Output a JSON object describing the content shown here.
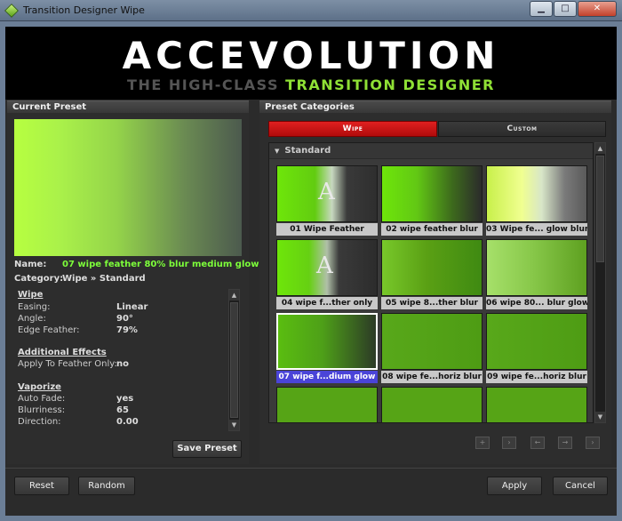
{
  "window": {
    "title": "Transition Designer Wipe",
    "minimize": "▁",
    "maximize": "□",
    "close": "✕"
  },
  "banner": {
    "brand": "ACCEVOLUTION",
    "tagline_dim": "THE HIGH-CLASS ",
    "tagline_accent": "TRANSITION DESIGNER"
  },
  "current_preset": {
    "header": "Current Preset",
    "name_label": "Name:",
    "name_value": "07 wipe feather 80% blur medium glow",
    "category_label": "Category:",
    "category_value": "Wipe » Standard",
    "sections": [
      {
        "title": "Wipe",
        "rows": [
          {
            "label": "Easing:",
            "value": "Linear"
          },
          {
            "label": "Angle:",
            "value": "90°"
          },
          {
            "label": "Edge Feather:",
            "value": "79%"
          }
        ]
      },
      {
        "title": "Additional Effects",
        "rows": [
          {
            "label": "Apply To Feather Only:",
            "value": "no"
          }
        ]
      },
      {
        "title": "Vaporize",
        "rows": [
          {
            "label": "Auto Fade:",
            "value": "yes"
          },
          {
            "label": "Blurriness:",
            "value": "65"
          },
          {
            "label": "Direction:",
            "value": "0.00"
          }
        ]
      }
    ],
    "save_button": "Save Preset"
  },
  "preset_categories": {
    "header": "Preset Categories",
    "tabs": [
      {
        "label": "Wipe",
        "active": true
      },
      {
        "label": "Custom",
        "active": false
      }
    ],
    "group": "Standard",
    "presets": [
      {
        "caption": "01 Wipe Feather",
        "glyph": "A"
      },
      {
        "caption": "02 wipe feather blur"
      },
      {
        "caption": "03 Wipe fe... glow blur"
      },
      {
        "caption": "04 wipe f...ther only",
        "glyph": "A"
      },
      {
        "caption": "05 wipe 8...ther blur"
      },
      {
        "caption": "06 wipe 80... blur glow"
      },
      {
        "caption": "07 wipe f...dium glow",
        "selected": true
      },
      {
        "caption": "08 wipe fe...horiz blur"
      },
      {
        "caption": "09 wipe fe...horiz blur"
      }
    ]
  },
  "footer": {
    "reset": "Reset",
    "random": "Random",
    "apply": "Apply",
    "cancel": "Cancel"
  },
  "colors": {
    "accent_green": "#8fe035",
    "selection_blue": "#4a44d8",
    "active_tab_red": "#d41818"
  }
}
